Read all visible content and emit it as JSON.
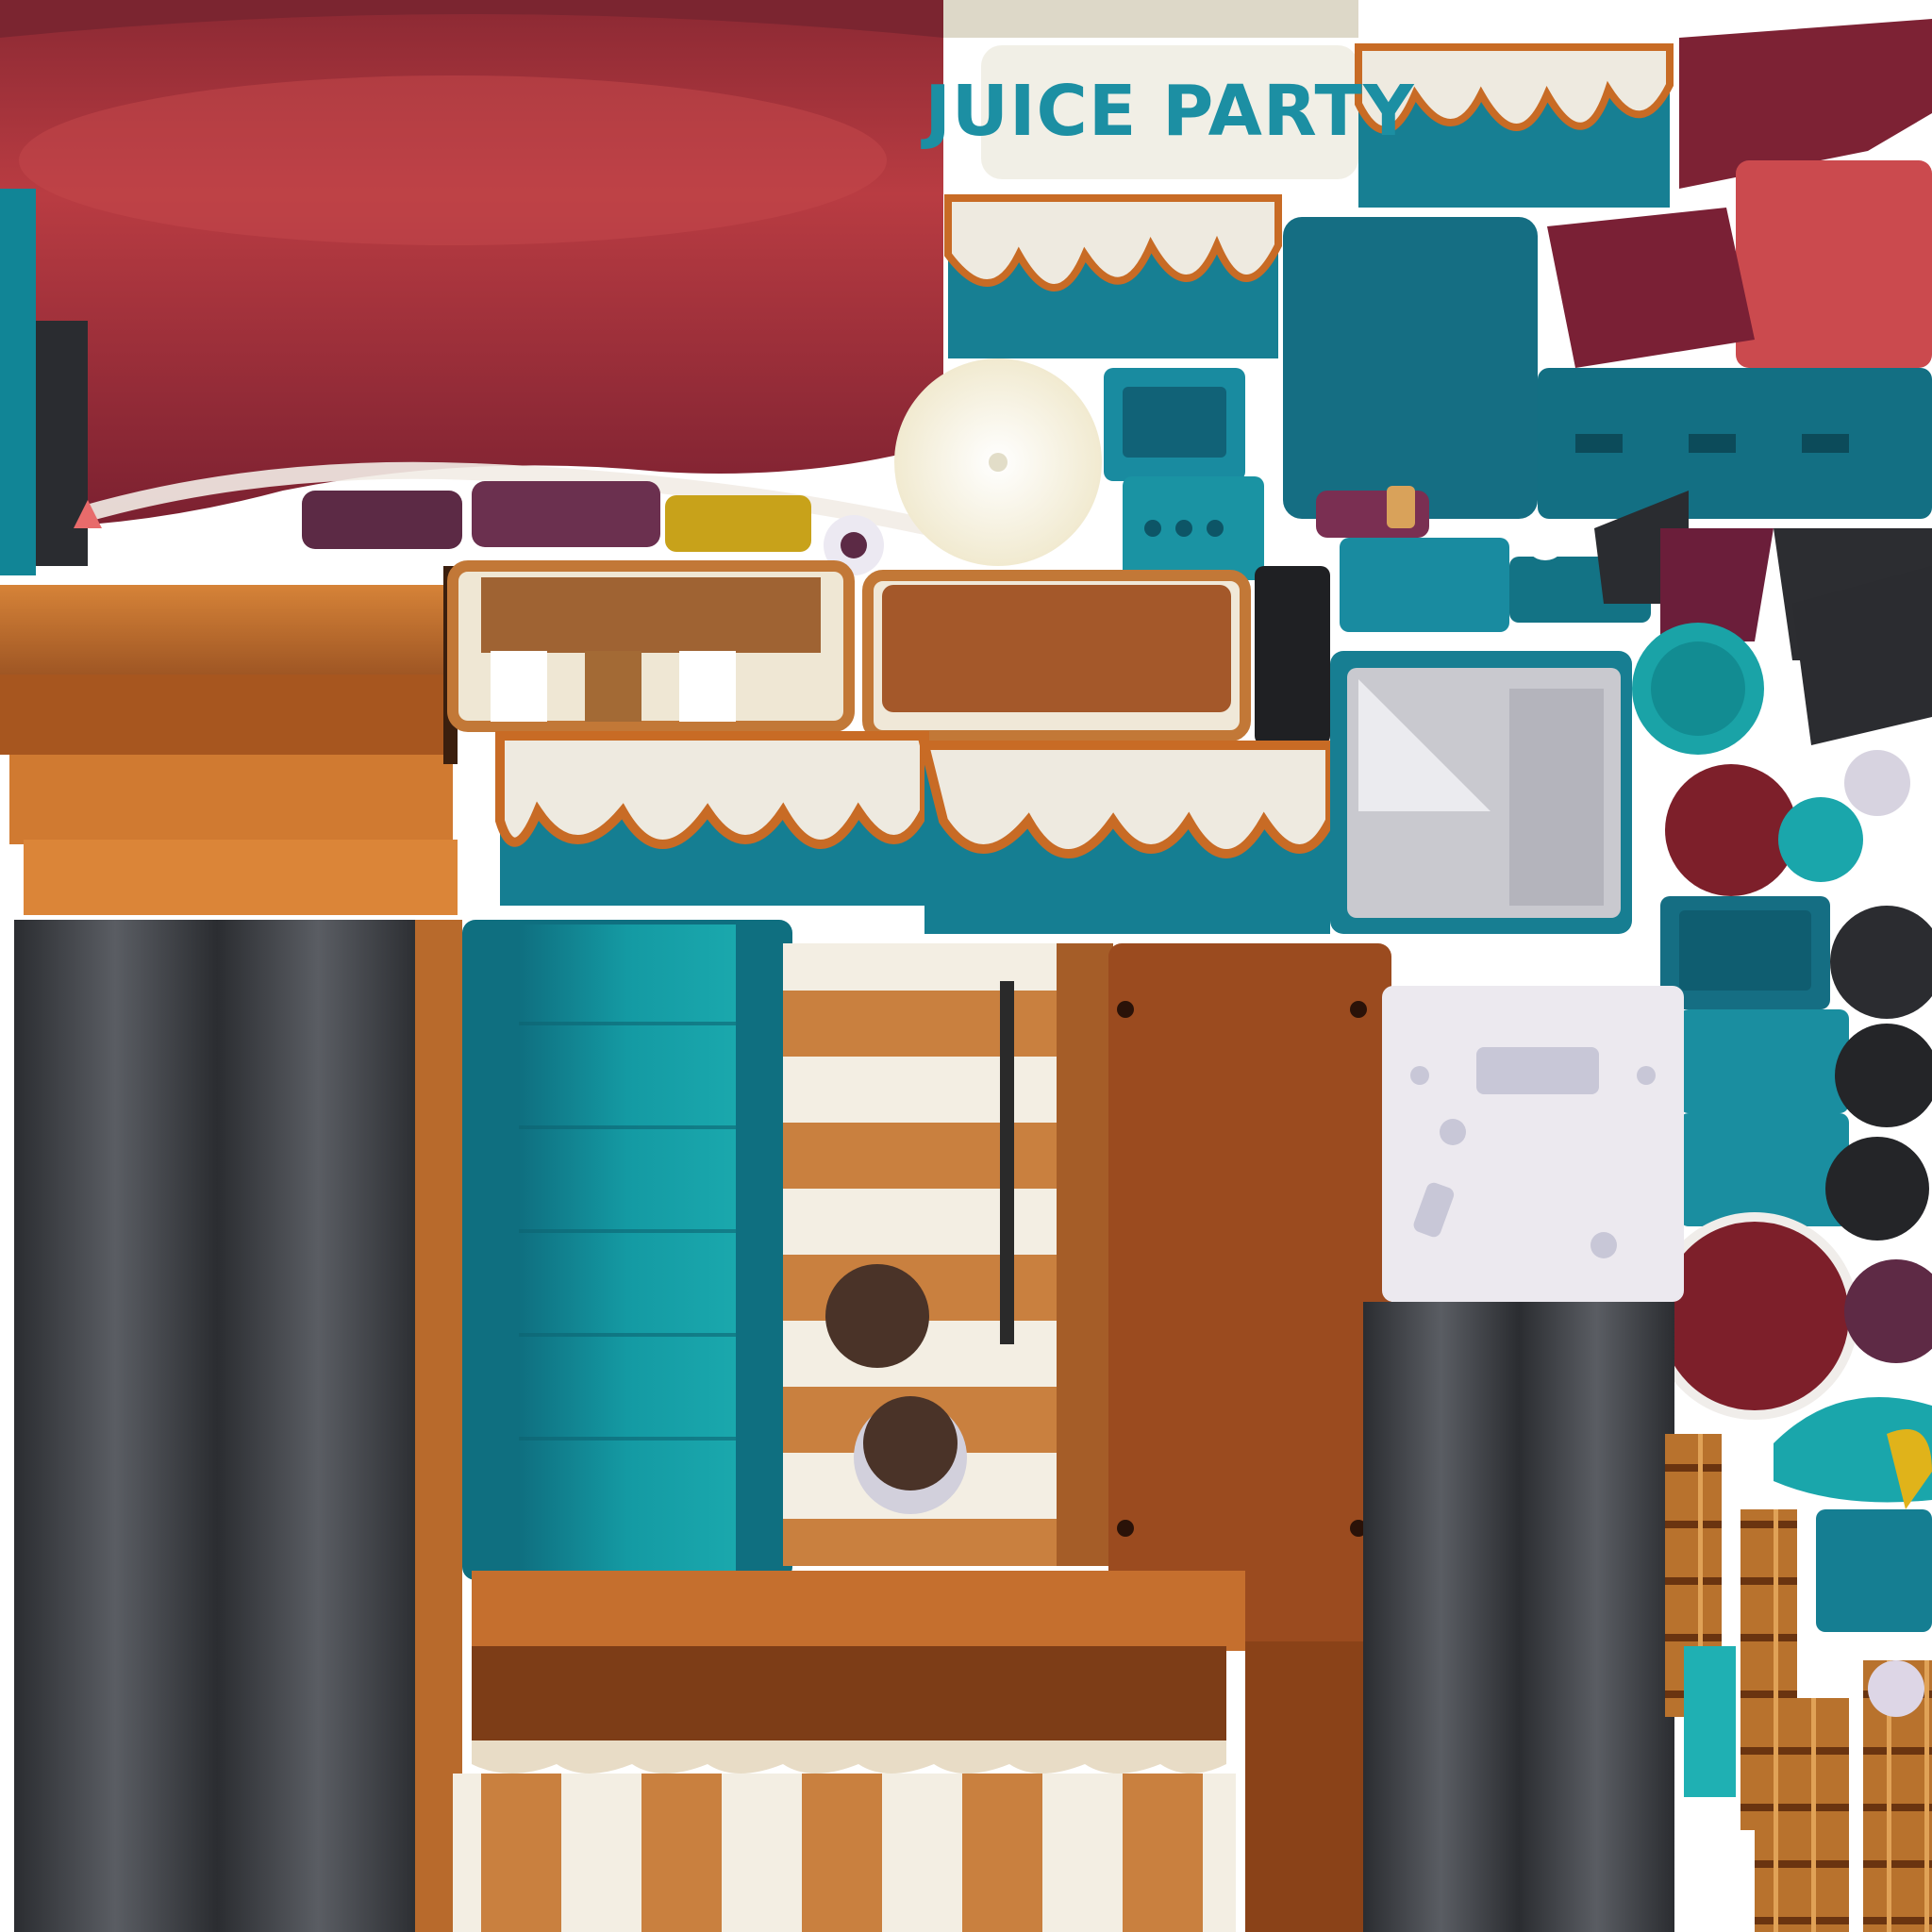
{
  "sign": {
    "text": "JUICE PARTY"
  },
  "palette": {
    "awning_red": "#b23a3f",
    "awning_dark": "#7d1f2a",
    "teal": "#147e91",
    "teal_light": "#20a7ad",
    "wood": "#c56f2e",
    "wood_dark": "#8c4a1f",
    "cream": "#eeeae0",
    "steel": "#4a4d52",
    "steel_dark": "#2a2c30",
    "plum": "#5e2a45",
    "mustard": "#c8a21a",
    "panel_grey": "#c9c9cf"
  },
  "icons": [
    "juice-glass-icon",
    "lemon-slice-icon",
    "gem-icon",
    "speaker-icon"
  ]
}
